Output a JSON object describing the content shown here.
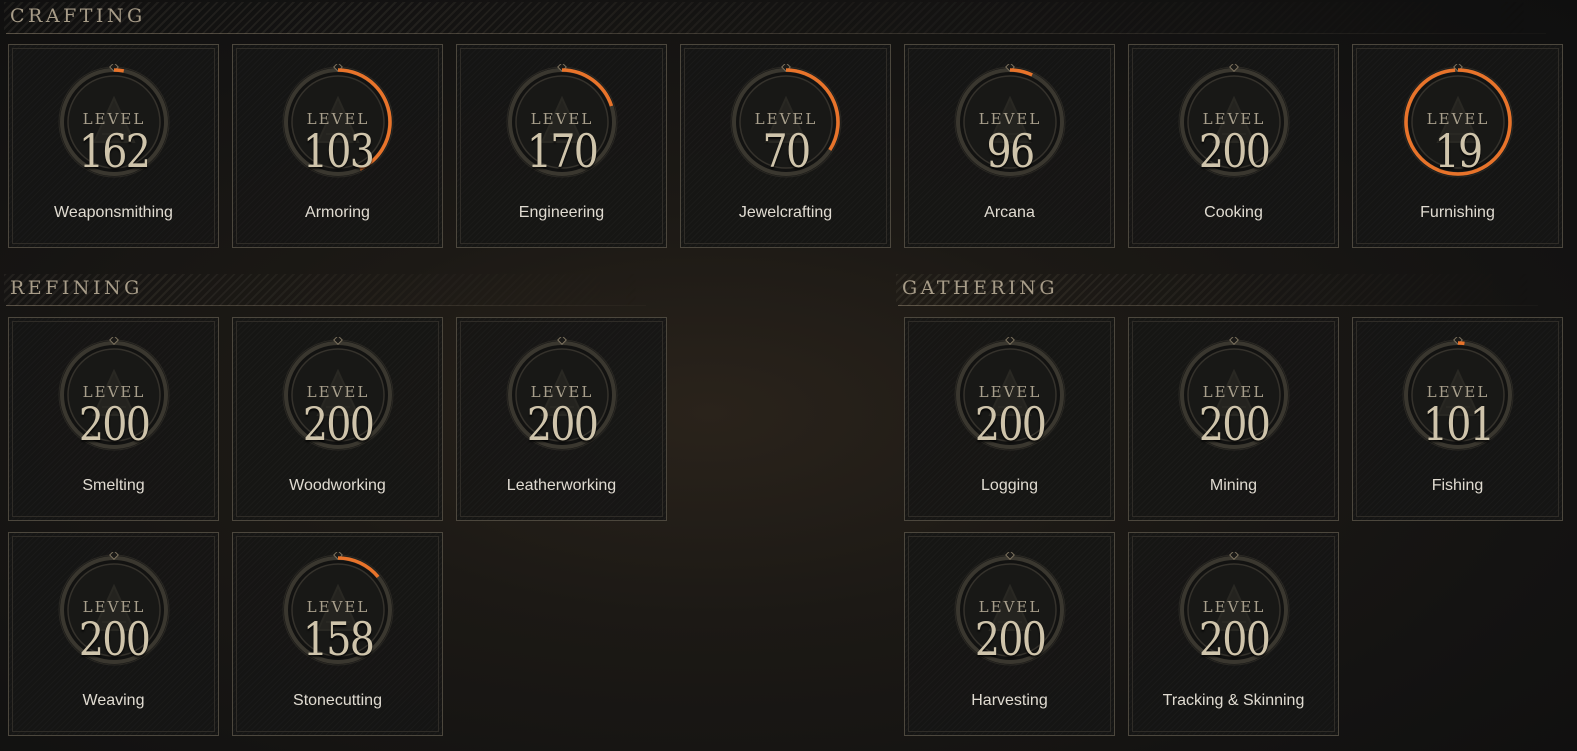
{
  "sections": {
    "crafting": "CRAFTING",
    "refining": "REFINING",
    "gathering": "GATHERING"
  },
  "level_label": "LEVEL",
  "colors": {
    "progress": "#e8732a",
    "ring": "#3a372f",
    "frame": "#4c473d"
  },
  "crafting": [
    {
      "name": "Weaponsmithing",
      "level": "162",
      "progress": 0.03,
      "icon": "sword-icon"
    },
    {
      "name": "Armoring",
      "level": "103",
      "progress": 0.43,
      "icon": "armor-icon"
    },
    {
      "name": "Engineering",
      "level": "170",
      "progress": 0.2,
      "icon": "gear-icon"
    },
    {
      "name": "Jewelcrafting",
      "level": "70",
      "progress": 0.34,
      "icon": "gem-icon"
    },
    {
      "name": "Arcana",
      "level": "96",
      "progress": 0.07,
      "icon": "arcana-book-icon"
    },
    {
      "name": "Cooking",
      "level": "200",
      "progress": 0,
      "icon": "cooking-pot-icon"
    },
    {
      "name": "Furnishing",
      "level": "19",
      "progress": 0.99,
      "icon": "furnishing-chair-icon"
    }
  ],
  "refining": [
    {
      "name": "Smelting",
      "level": "200",
      "progress": 0,
      "icon": "furnace-icon"
    },
    {
      "name": "Woodworking",
      "level": "200",
      "progress": 0,
      "icon": "woodworking-icon"
    },
    {
      "name": "Leatherworking",
      "level": "200",
      "progress": 0,
      "icon": "leather-icon"
    },
    {
      "name": "Weaving",
      "level": "200",
      "progress": 0,
      "icon": "weaving-icon"
    },
    {
      "name": "Stonecutting",
      "level": "158",
      "progress": 0.14,
      "icon": "stone-icon"
    }
  ],
  "gathering": [
    {
      "name": "Logging",
      "level": "200",
      "progress": 0,
      "icon": "axe-icon"
    },
    {
      "name": "Mining",
      "level": "200",
      "progress": 0,
      "icon": "pickaxe-icon"
    },
    {
      "name": "Fishing",
      "level": "101",
      "progress": 0.02,
      "icon": "fish-icon"
    },
    {
      "name": "Harvesting",
      "level": "200",
      "progress": 0,
      "icon": "sickle-icon"
    },
    {
      "name": "Tracking & Skinning",
      "level": "200",
      "progress": 0,
      "icon": "skinning-knife-icon"
    }
  ]
}
